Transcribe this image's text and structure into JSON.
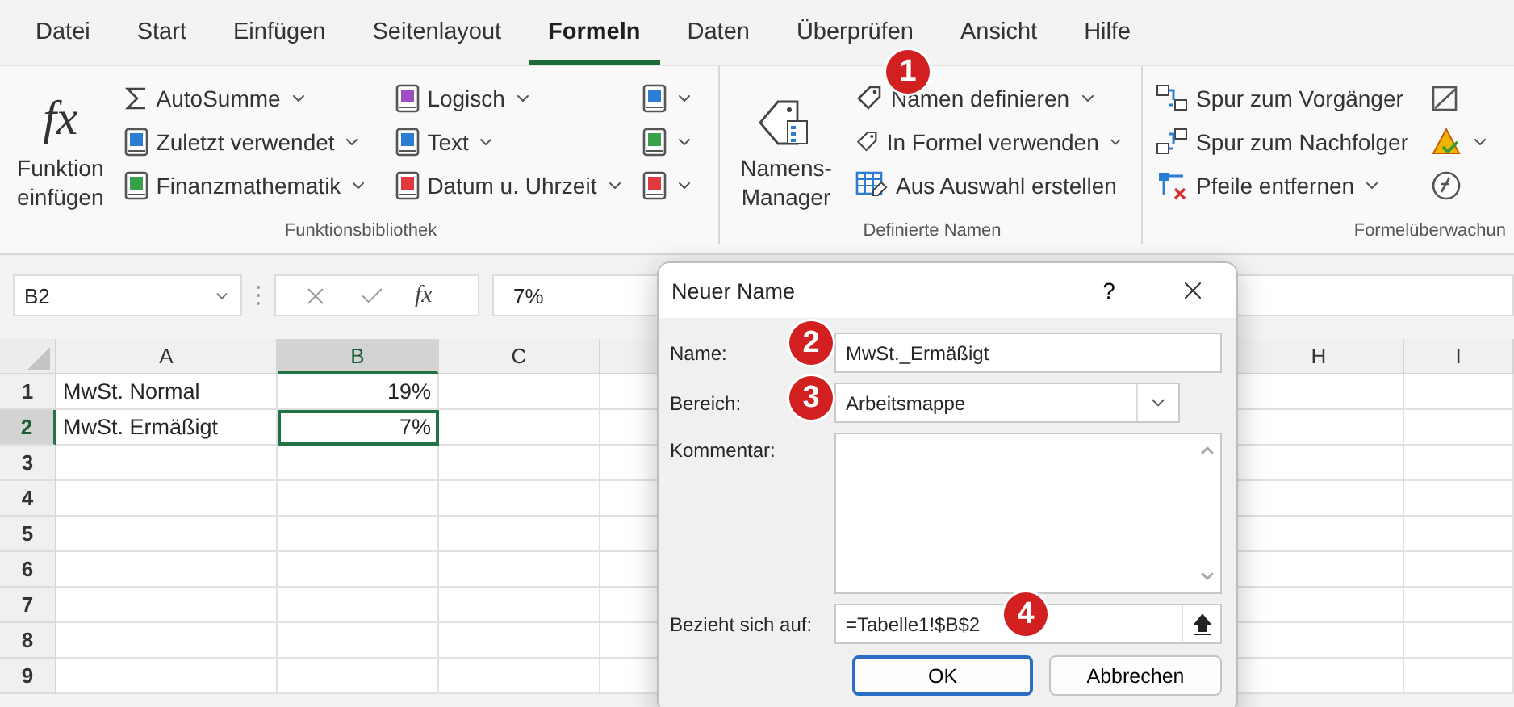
{
  "menu_tabs": [
    {
      "label": "Datei",
      "selected": false
    },
    {
      "label": "Start",
      "selected": false
    },
    {
      "label": "Einfügen",
      "selected": false
    },
    {
      "label": "Seitenlayout",
      "selected": false
    },
    {
      "label": "Formeln",
      "selected": true
    },
    {
      "label": "Daten",
      "selected": false
    },
    {
      "label": "Überprüfen",
      "selected": false
    },
    {
      "label": "Ansicht",
      "selected": false
    },
    {
      "label": "Hilfe",
      "selected": false
    }
  ],
  "ribbon": {
    "groups": [
      {
        "label": "Funktionsbibliothek",
        "large_button": {
          "symbol": "fx",
          "label": "Funktion einfügen"
        },
        "columns": [
          [
            {
              "label": "AutoSumme",
              "dropdown": true
            },
            {
              "label": "Zuletzt verwendet",
              "dropdown": true
            },
            {
              "label": "Finanzmathematik",
              "dropdown": true
            }
          ],
          [
            {
              "label": "Logisch",
              "dropdown": true
            },
            {
              "label": "Text",
              "dropdown": true
            },
            {
              "label": "Datum u. Uhrzeit",
              "dropdown": true
            }
          ],
          [
            {
              "dropdown": true
            },
            {
              "dropdown": true
            },
            {
              "dropdown": true
            }
          ]
        ]
      },
      {
        "label": "Definierte Namen",
        "large_button": {
          "label": "Namens-Manager"
        },
        "columns": [
          [
            {
              "label": "Namen definieren",
              "dropdown": true
            },
            {
              "label": "In Formel verwenden",
              "dropdown": true
            },
            {
              "label": "Aus Auswahl erstellen",
              "dropdown": false
            }
          ]
        ]
      },
      {
        "label": "Formelüberwachun",
        "columns": [
          [
            {
              "label": "Spur zum Vorgänger",
              "dropdown": false
            },
            {
              "label": "Spur zum Nachfolger",
              "dropdown": false
            },
            {
              "label": "Pfeile entfernen",
              "dropdown": true
            }
          ],
          [
            {
              "dropdown": false
            },
            {
              "dropdown": true
            },
            {
              "dropdown": false
            }
          ]
        ]
      }
    ]
  },
  "formula_bar": {
    "name_box": "B2",
    "function_symbol": "fx",
    "content": "7%"
  },
  "sheet": {
    "columns": [
      {
        "label": "A",
        "selected": false
      },
      {
        "label": "B",
        "selected": true
      },
      {
        "label": "C",
        "selected": false
      },
      {
        "label": "H",
        "selected": false
      },
      {
        "label": "I",
        "selected": false
      }
    ],
    "rows": [
      {
        "header": "1",
        "cells": [
          {
            "text": "MwSt. Normal",
            "selected": false
          },
          {
            "text": "19%",
            "selected": false
          }
        ]
      },
      {
        "header": "2",
        "cells": [
          {
            "text": "MwSt. Ermäßigt",
            "selected": false
          },
          {
            "text": "7%",
            "selected": true
          }
        ]
      },
      {
        "header": "3"
      },
      {
        "header": "4"
      },
      {
        "header": "5"
      },
      {
        "header": "6"
      },
      {
        "header": "7"
      },
      {
        "header": "8"
      },
      {
        "header": "9"
      }
    ]
  },
  "dialog": {
    "title": "Neuer Name",
    "help": "?",
    "name": {
      "label": "Name:",
      "value": "MwSt._Ermäßigt"
    },
    "scope": {
      "label": "Bereich:",
      "value": "Arbeitsmappe"
    },
    "comment": {
      "label": "Kommentar:"
    },
    "refers_to": {
      "label": "Bezieht sich auf:",
      "value": "=Tabelle1!$B$2"
    },
    "buttons": [
      {
        "label": "OK",
        "default": true
      },
      {
        "label": "Abbrechen",
        "default": false
      }
    ]
  },
  "callouts": [
    {
      "number": "1"
    },
    {
      "number": "2"
    },
    {
      "number": "3"
    },
    {
      "number": "4"
    }
  ]
}
